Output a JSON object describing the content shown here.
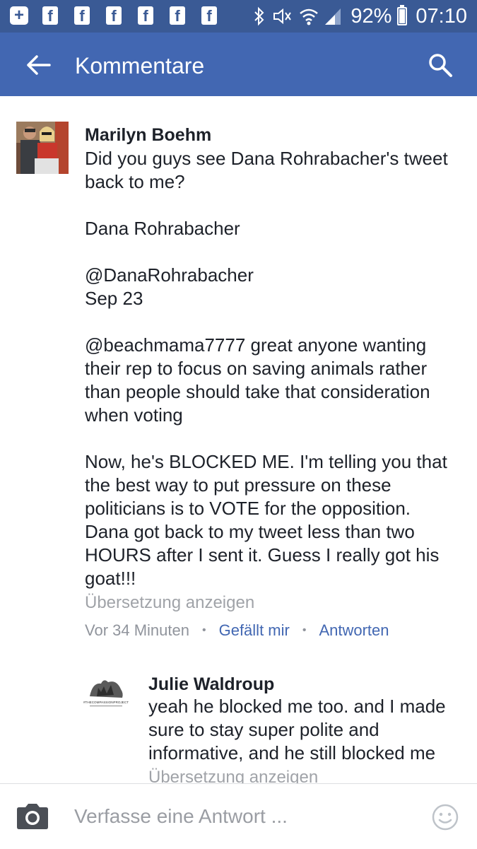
{
  "status_bar": {
    "notification_icons": [
      "add-icon",
      "facebook-icon",
      "facebook-icon",
      "facebook-icon",
      "facebook-icon",
      "facebook-icon",
      "facebook-icon"
    ],
    "plus_glyph": "+",
    "fb_glyph": "f",
    "battery_percent": "92%",
    "battery_level": 0.92,
    "time": "07:10"
  },
  "app_bar": {
    "title": "Kommentare",
    "color": "#4267b2"
  },
  "comments": [
    {
      "author": "Marilyn Boehm",
      "body": "Did you guys see Dana Rohrabacher's tweet back to me?\n\nDana Rohrabacher\n\n@DanaRohrabacher\nSep 23\n\n@beachmama7777 great anyone wanting their rep to focus on saving animals rather than people should take that consideration when voting\n\nNow, he's BLOCKED ME. I'm telling you that the best way to put pressure on these politicians is to VOTE for the opposition. Dana got back to my tweet less than two HOURS after I sent it. Guess I really got his goat!!!",
      "translate": "Übersetzung anzeigen",
      "time": "Vor 34 Minuten",
      "like": "Gefällt mir",
      "reply": "Antworten"
    },
    {
      "author": "Julie Waldroup",
      "body": "yeah he blocked me too. and I made sure to stay super polite and informative, and he still blocked me",
      "translate": "Übersetzung anzeigen",
      "avatar_text": "#THECOMPASSIONPROJECT"
    }
  ],
  "composer": {
    "placeholder": "Verfasse eine Antwort ..."
  }
}
